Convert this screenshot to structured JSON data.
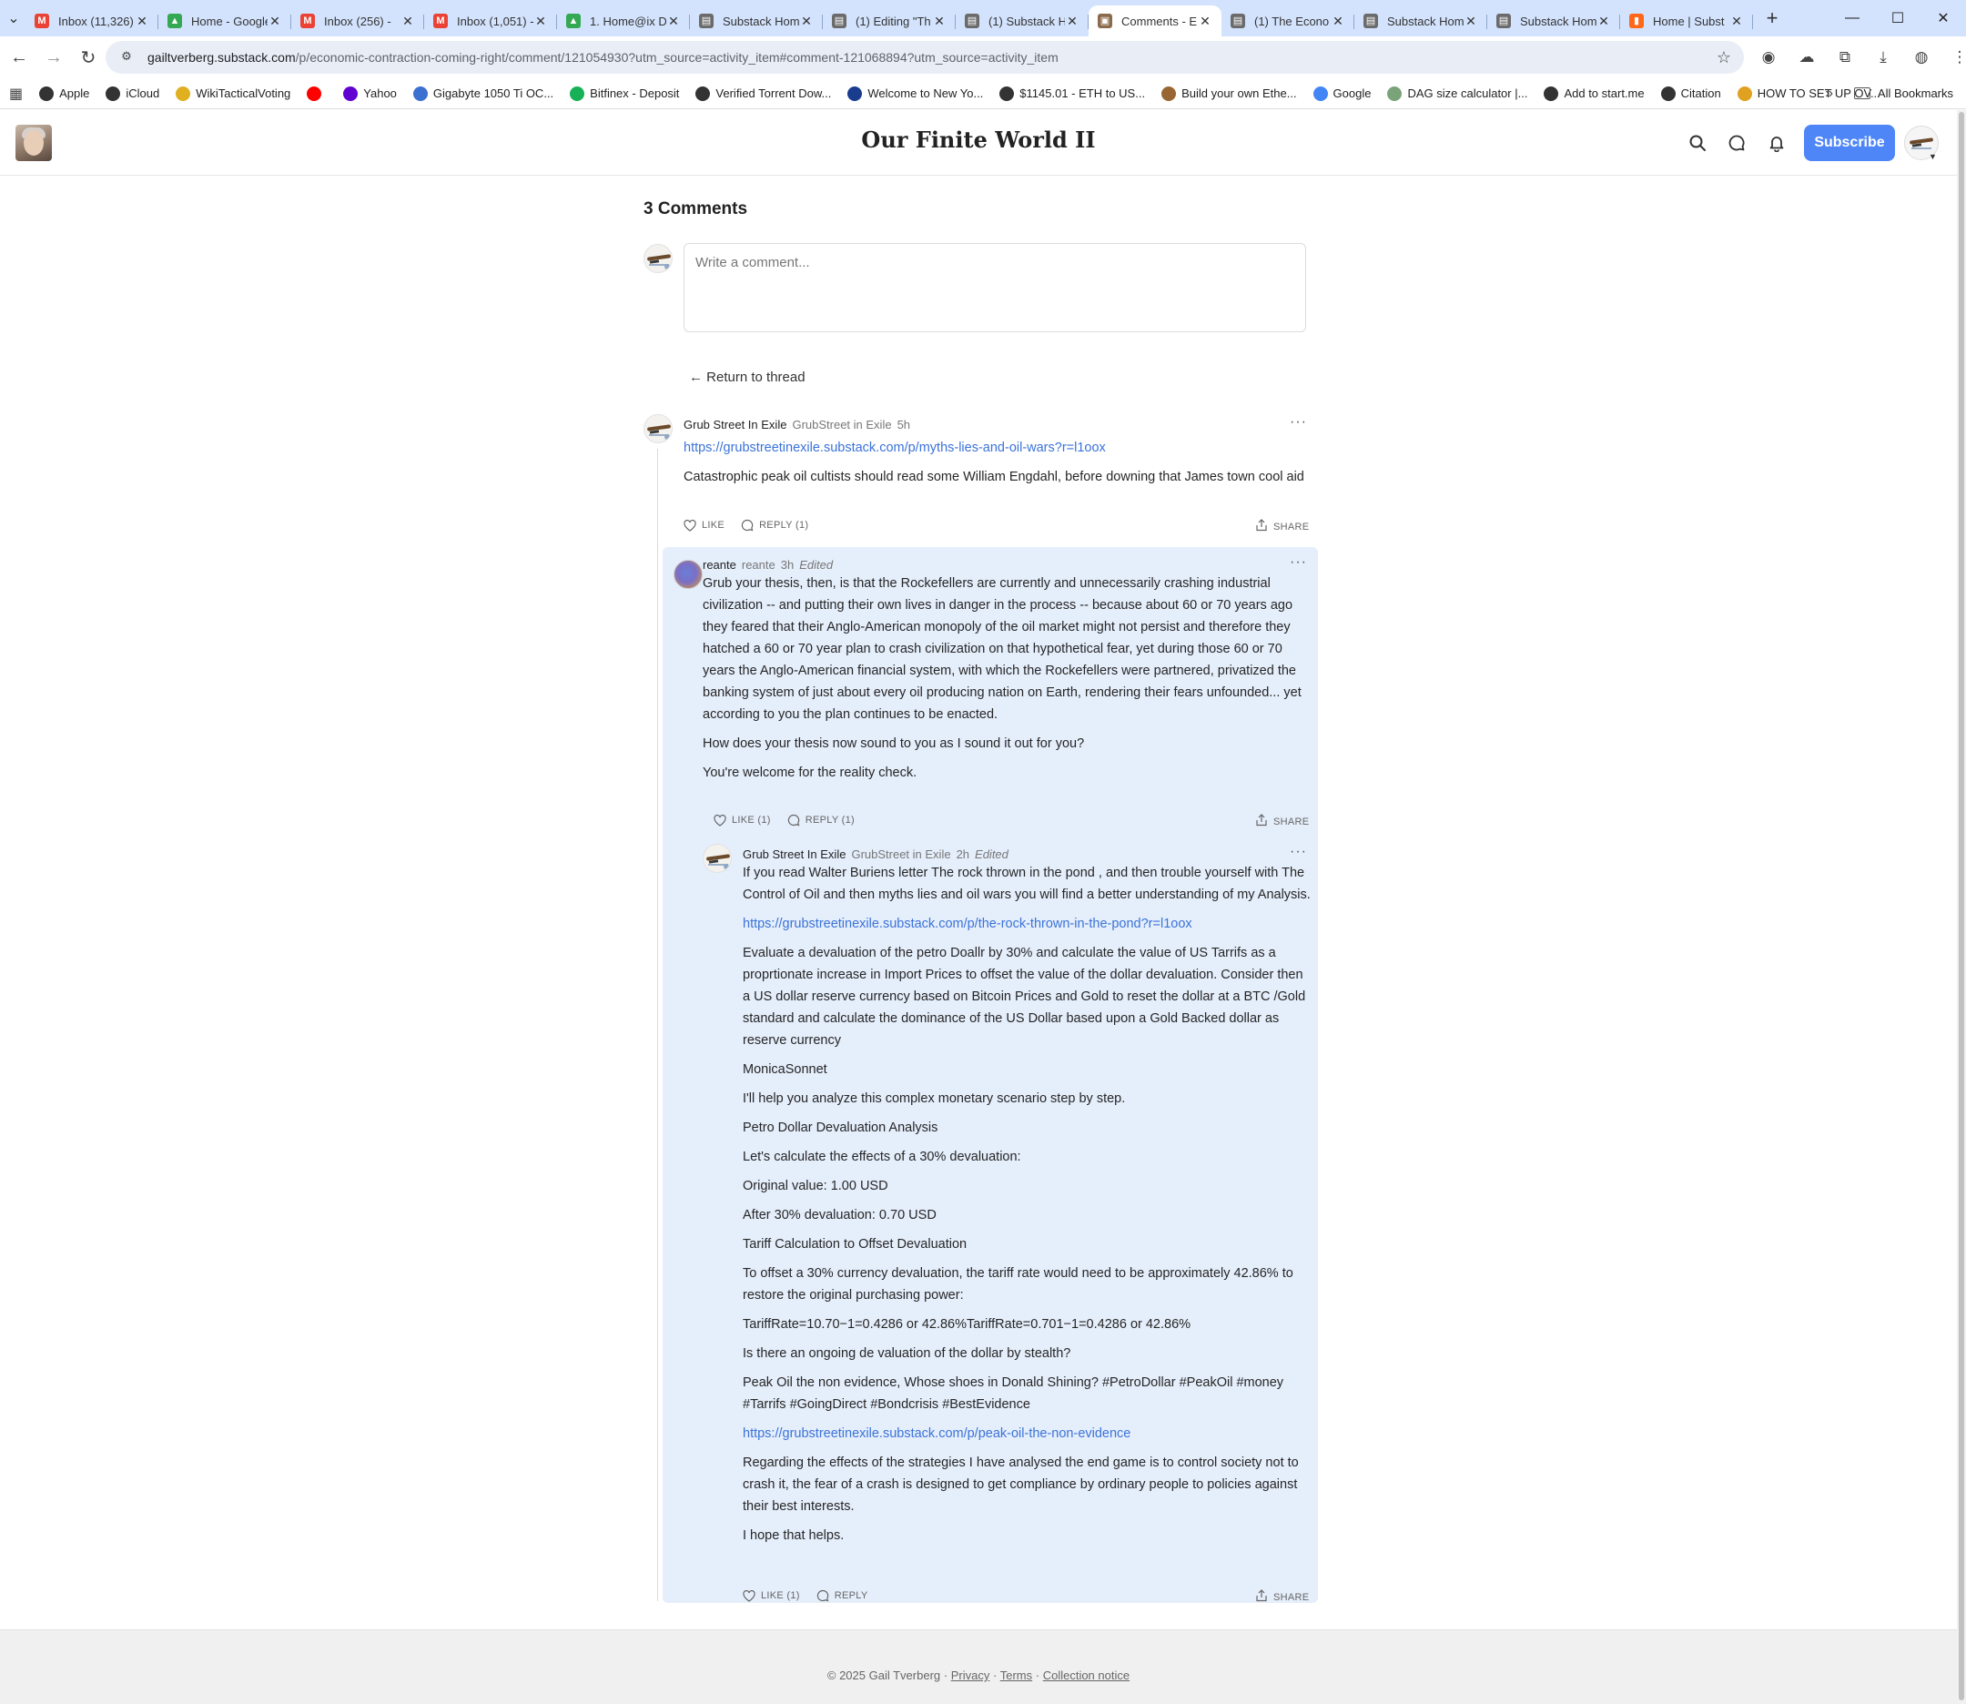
{
  "browser": {
    "tabs": [
      {
        "title": "Inbox (11,326) -",
        "fav": "M",
        "color": "#ea4335",
        "active": false
      },
      {
        "title": "Home - Google",
        "fav": "▲",
        "color": "#34a853",
        "active": false
      },
      {
        "title": "Inbox (256) -",
        "fav": "M",
        "color": "#ea4335",
        "active": false
      },
      {
        "title": "Inbox (1,051) -",
        "fav": "M",
        "color": "#ea4335",
        "active": false
      },
      {
        "title": "1. Home@ix D",
        "fav": "▲",
        "color": "#34a853",
        "active": false
      },
      {
        "title": "Substack Home",
        "fav": "▤",
        "color": "#6b6b6b",
        "active": false
      },
      {
        "title": "(1) Editing \"Th",
        "fav": "▤",
        "color": "#6b6b6b",
        "active": false
      },
      {
        "title": "(1) Substack H",
        "fav": "▤",
        "color": "#6b6b6b",
        "active": false
      },
      {
        "title": "Comments - E",
        "fav": "▣",
        "color": "#8b6b4b",
        "active": true
      },
      {
        "title": "(1) The Econo",
        "fav": "▤",
        "color": "#6b6b6b",
        "active": false
      },
      {
        "title": "Substack Hom",
        "fav": "▤",
        "color": "#6b6b6b",
        "active": false
      },
      {
        "title": "Substack Hom",
        "fav": "▤",
        "color": "#6b6b6b",
        "active": false
      },
      {
        "title": "Home | Subst",
        "fav": "▮",
        "color": "#ff6719",
        "active": false
      }
    ],
    "url_host": "gailtverberg.substack.com",
    "url_path": "/p/economic-contraction-coming-right/comment/121054930?utm_source=activity_item#comment-121068894?utm_source=activity_item",
    "bookmarks": [
      {
        "label": "Apple",
        "color": "#333"
      },
      {
        "label": "iCloud",
        "color": "#333"
      },
      {
        "label": "WikiTacticalVoting",
        "color": "#e0b020"
      },
      {
        "label": "",
        "color": "#ff0000"
      },
      {
        "label": "Yahoo",
        "color": "#6001d2"
      },
      {
        "label": "Gigabyte 1050 Ti OC...",
        "color": "#3b6fd0"
      },
      {
        "label": "Bitfinex - Deposit",
        "color": "#16b157"
      },
      {
        "label": "Verified Torrent Dow...",
        "color": "#333"
      },
      {
        "label": "Welcome to New Yo...",
        "color": "#1a3c8f"
      },
      {
        "label": "$1145.01 - ETH to US...",
        "color": "#333"
      },
      {
        "label": "Build your own Ethe...",
        "color": "#996633"
      },
      {
        "label": "Google",
        "color": "#4285f4"
      },
      {
        "label": "DAG size calculator |...",
        "color": "#7aa37a"
      },
      {
        "label": "Add to start.me",
        "color": "#333"
      },
      {
        "label": "Citation",
        "color": "#333"
      },
      {
        "label": "HOW TO SET UP OV...",
        "color": "#e0a020"
      }
    ],
    "all_bookmarks": "All Bookmarks"
  },
  "header": {
    "publication": "Our Finite World II",
    "subscribe": "Subscribe"
  },
  "comments": {
    "heading": "3 Comments",
    "compose_placeholder": "Write a comment...",
    "return_link": "← Return to thread",
    "c1": {
      "name": "Grub Street In Exile",
      "handle": "GrubStreet in Exile",
      "time": "5h",
      "link": "https://grubstreetinexile.substack.com/p/myths-lies-and-oil-wars?r=l1oox",
      "text": "Catastrophic peak oil cultists should read some William Engdahl, before downing that James town cool aid",
      "like": "LIKE",
      "reply": "REPLY (1)",
      "share": "SHARE"
    },
    "c2": {
      "name": "reante",
      "handle": "reante",
      "time": "3h",
      "edited": "Edited",
      "paragraphs": [
        "Grub your thesis, then, is that the Rockefellers are currently and unnecessarily crashing industrial civilization -- and putting their own lives in danger in the process -- because about 60 or 70 years ago they feared that their Anglo-American monopoly of the oil market might not persist and therefore they hatched a 60 or 70 year plan to crash civilization on that hypothetical fear, yet during those 60 or 70 years the Anglo-American financial system, with which the Rockefellers were partnered, privatized the banking system of just about every oil producing nation on Earth, rendering their fears unfounded... yet according to you the plan continues to be enacted.",
        "How does your thesis now sound to you as I sound it out for you?",
        "You're welcome for the reality check."
      ],
      "like": "LIKE (1)",
      "reply": "REPLY (1)",
      "share": "SHARE"
    },
    "c3": {
      "name": "Grub Street In Exile",
      "handle": "GrubStreet in Exile",
      "time": "2h",
      "edited": "Edited",
      "p1": "If you read Walter Buriens letter The rock thrown in the pond , and then trouble yourself with The Control of Oil and then myths lies and oil wars you will find a better understanding of my Analysis.",
      "link1": "https://grubstreetinexile.substack.com/p/the-rock-thrown-in-the-pond?r=l1oox",
      "p2": "Evaluate a devaluation of the petro Doallr by 30% and calculate the value of US Tarrifs as a proprtionate increase in Import Prices to offset the value of the dollar devaluation. Consider then a US dollar reserve currency based on Bitcoin Prices and Gold to reset the dollar at a BTC /Gold standard and calculate the dominance of the US Dollar based upon a Gold Backed dollar as reserve currency",
      "p3": "MonicaSonnet",
      "p4": "I'll help you analyze this complex monetary scenario step by step.",
      "p5": "Petro Dollar Devaluation Analysis",
      "p6": "Let's calculate the effects of a 30% devaluation:",
      "p7": "Original value: 1.00 USD",
      "p8": "After 30% devaluation: 0.70 USD",
      "p9": "Tariff Calculation to Offset Devaluation",
      "p10": "To offset a 30% currency devaluation, the tariff rate would need to be approximately 42.86% to restore the original purchasing power:",
      "p11": "TariffRate=10.70−1=0.4286 or 42.86%TariffRate=0.701−1=0.4286 or 42.86%",
      "p12": "Is there an ongoing de valuation of the dollar by stealth?",
      "p13": "Peak Oil the non evidence, Whose shoes in Donald Shining? #PetroDollar #PeakOil #money #Tarrifs #GoingDirect #Bondcrisis #BestEvidence",
      "link2": "https://grubstreetinexile.substack.com/p/peak-oil-the-non-evidence",
      "p14": "Regarding the effects of the strategies I have analysed the end game is to control society not to crash it, the fear of a crash is designed to get compliance by ordinary people to policies against their best interests.",
      "p15": "I hope that helps.",
      "like": "LIKE (1)",
      "reply": "REPLY",
      "share": "SHARE"
    }
  },
  "footer": {
    "copyright": "© 2025 Gail Tverberg",
    "sep": "·",
    "privacy": "Privacy",
    "terms": "Terms",
    "collection": "Collection notice"
  }
}
